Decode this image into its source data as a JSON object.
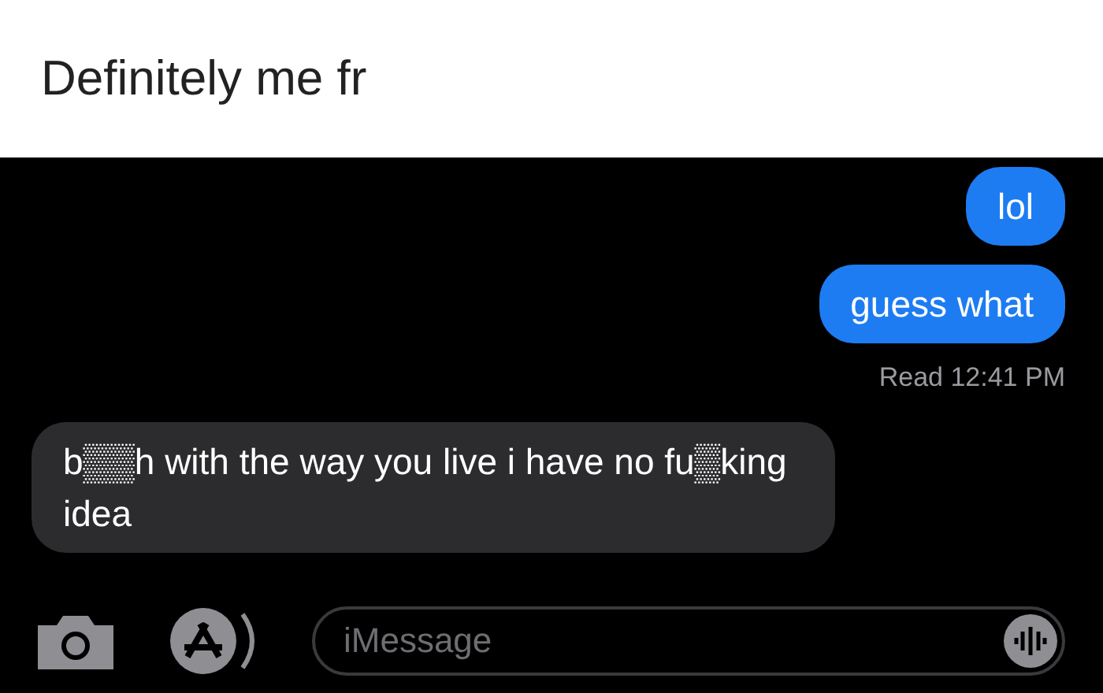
{
  "caption": "Definitely me fr",
  "messages": [
    {
      "text": "lol",
      "kind": "sent"
    },
    {
      "text": "guess what",
      "kind": "sent"
    },
    {
      "text": "b▒▒h with the way you live i have no fu▒king idea",
      "kind": "received"
    }
  ],
  "receipt": "Read 12:41 PM",
  "composer": {
    "placeholder": "iMessage"
  }
}
